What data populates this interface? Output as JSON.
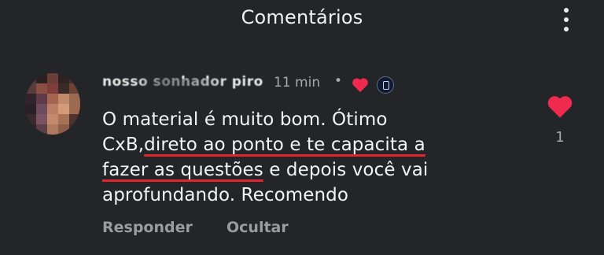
{
  "header": {
    "title": "Comentários"
  },
  "comment": {
    "username": "nosso sonhador piro",
    "time": "11 min",
    "separator": "•",
    "text_lines": [
      {
        "plain_before": "O material é muito bom. Ótimo",
        "underlined": "",
        "plain_after": ""
      },
      {
        "plain_before": "CxB,",
        "underlined": "direto ao ponto e te capacita a",
        "plain_after": ""
      },
      {
        "plain_before": "",
        "underlined": "fazer as questões",
        "plain_after": " e depois você vai"
      },
      {
        "plain_before": "aprofundando. Recomendo",
        "underlined": "",
        "plain_after": ""
      }
    ],
    "actions": {
      "reply": "Responder",
      "hide": "Ocultar"
    },
    "like_count": "1"
  },
  "colors": {
    "background": "#242528",
    "heart": "#ee2a4f",
    "underline": "#e1262c"
  },
  "icons": {
    "menu": "more-vertical-icon",
    "creator_heart": "heart-icon",
    "like": "heart-icon"
  }
}
